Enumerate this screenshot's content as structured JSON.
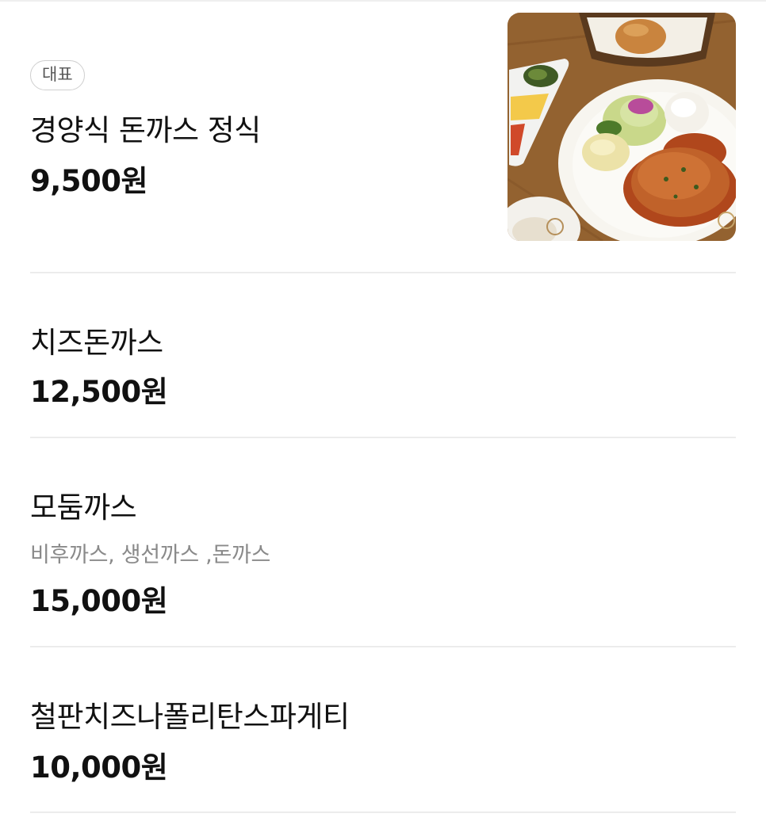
{
  "menu": {
    "items": [
      {
        "badge": "대표",
        "name": "경양식 돈까스 정식",
        "price": "9,500원",
        "has_image": true
      },
      {
        "name": "치즈돈까스",
        "price": "12,500원"
      },
      {
        "name": "모둠까스",
        "description": "비후까스, 생선까스 ,돈까스",
        "price": "15,000원"
      },
      {
        "name": "철판치즈나폴리탄스파게티",
        "price": "10,000원"
      }
    ]
  },
  "colors": {
    "text_primary": "#111111",
    "text_secondary": "#8a8a8a",
    "divider": "#ececec",
    "badge_border": "#cfcfcf"
  }
}
